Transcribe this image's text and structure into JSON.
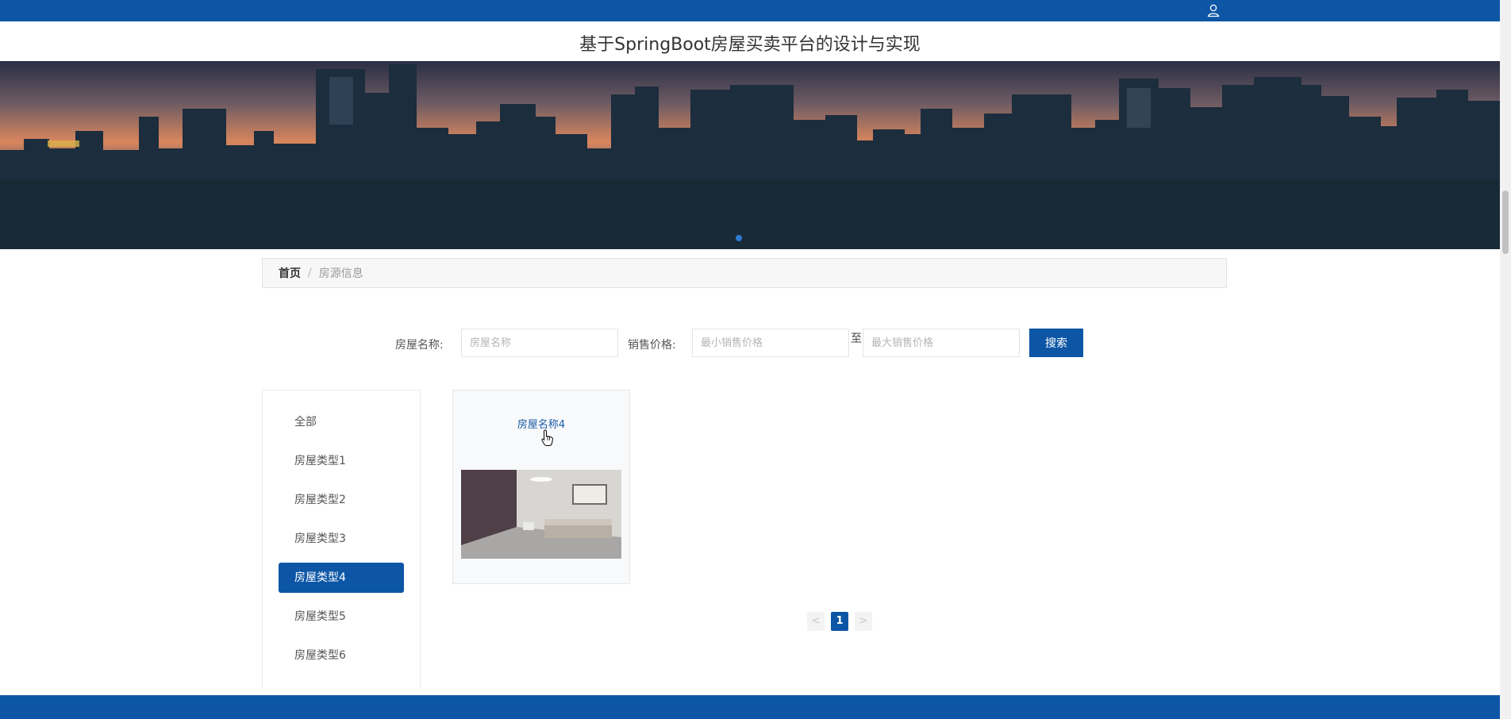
{
  "header": {
    "title": "基于SpringBoot房屋买卖平台的设计与实现",
    "user_icon": "user-icon"
  },
  "breadcrumb": {
    "home": "首页",
    "separator": "/",
    "current": "房源信息"
  },
  "search": {
    "name_label": "房屋名称:",
    "name_placeholder": "房屋名称",
    "price_label": "销售价格:",
    "min_placeholder": "最小销售价格",
    "to_text": "至",
    "max_placeholder": "最大销售价格",
    "button_label": "搜索"
  },
  "sidebar": {
    "items": [
      {
        "label": "全部",
        "active": false
      },
      {
        "label": "房屋类型1",
        "active": false
      },
      {
        "label": "房屋类型2",
        "active": false
      },
      {
        "label": "房屋类型3",
        "active": false
      },
      {
        "label": "房屋类型4",
        "active": true
      },
      {
        "label": "房屋类型5",
        "active": false
      },
      {
        "label": "房屋类型6",
        "active": false
      }
    ]
  },
  "listings": [
    {
      "title": "房屋名称4"
    }
  ],
  "pagination": {
    "prev": "<",
    "current": "1",
    "next": ">"
  },
  "colors": {
    "primary": "#0d56a6",
    "link": "#1b5aa6"
  }
}
